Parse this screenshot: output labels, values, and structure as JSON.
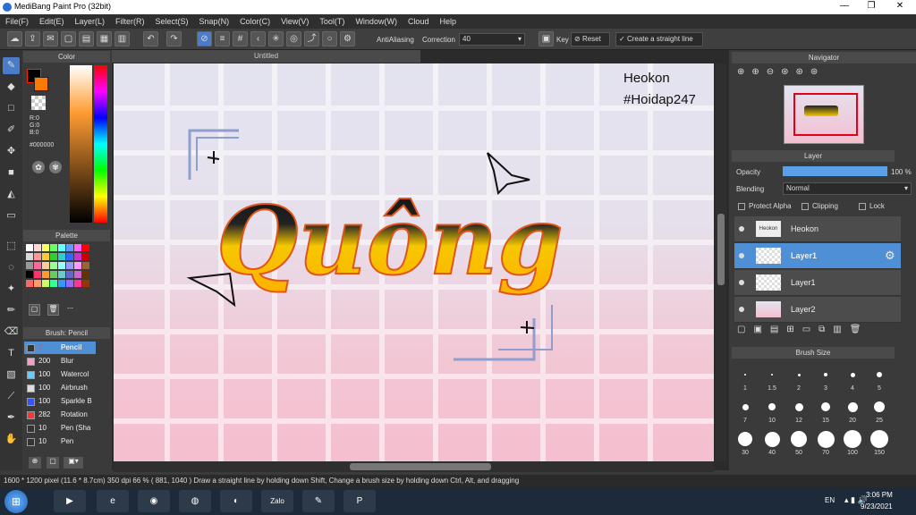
{
  "window": {
    "title": "MediBang Paint Pro (32bit)",
    "minimize": "—",
    "maximize": "❐",
    "close": "✕"
  },
  "menu": [
    "File(F)",
    "Edit(E)",
    "Layer(L)",
    "Filter(R)",
    "Select(S)",
    "Snap(N)",
    "Color(C)",
    "View(V)",
    "Tool(T)",
    "Window(W)",
    "Cloud",
    "Help"
  ],
  "toolbar": {
    "antialiasing": "AntiAliasing",
    "correction_label": "Correction",
    "correction_value": "40",
    "key_label": "Key",
    "reset_label": "Reset",
    "straight_line_label": "Create a straight line"
  },
  "color_panel": {
    "title": "Color",
    "r": "R:0",
    "g": "G:0",
    "b": "B:0",
    "hex": "#000000"
  },
  "palette_panel": {
    "title": "Palette",
    "dash": "---",
    "colors": [
      "#ffffff",
      "#ffd8d8",
      "#ffff66",
      "#66ff66",
      "#66ffff",
      "#6699ff",
      "#ff66ff",
      "#ff0000",
      "#d9d9d9",
      "#ff9999",
      "#ffcc33",
      "#33cc33",
      "#33cccc",
      "#3366ff",
      "#cc33cc",
      "#cc0000",
      "#999999",
      "#ff6699",
      "#ffcc99",
      "#99ff99",
      "#99ffff",
      "#9999ff",
      "#ff99ff",
      "#996633",
      "#000000",
      "#ff3366",
      "#ff9933",
      "#66cc66",
      "#66cccc",
      "#6666cc",
      "#cc66cc",
      "#663300",
      "#ff6666",
      "#ff9966",
      "#ccff66",
      "#33ff99",
      "#3399ff",
      "#9966ff",
      "#ff3399",
      "#993300"
    ]
  },
  "brush_panel": {
    "title": "Brush: Pencil",
    "brushes": [
      {
        "size": "7",
        "name": "Pencil",
        "color": "#333333"
      },
      {
        "size": "200",
        "name": "Blur",
        "color": "#ff99cc"
      },
      {
        "size": "100",
        "name": "Watercol",
        "color": "#66ccff"
      },
      {
        "size": "100",
        "name": "Airbrush",
        "color": "#dddddd"
      },
      {
        "size": "100",
        "name": "Sparkle B",
        "color": "#3355ff"
      },
      {
        "size": "282",
        "name": "Rotation",
        "color": "#ff3333"
      },
      {
        "size": "10",
        "name": "Pen (Sha",
        "color": "#333333"
      },
      {
        "size": "10",
        "name": "Pen",
        "color": "#333333"
      }
    ]
  },
  "canvas": {
    "tab_title": "Untitled",
    "text1": "Heokon",
    "text2": "#Hoidap247",
    "lettering": "Quông"
  },
  "navigator": {
    "title": "Navigator"
  },
  "layer_panel": {
    "title": "Layer",
    "opacity_label": "Opacity",
    "opacity_value": "100 %",
    "opacity_level": 1.0,
    "blending_label": "Blending",
    "blending_value": "Normal",
    "protect_alpha": "Protect Alpha",
    "clipping": "Clipping",
    "lock": "Lock",
    "layers": [
      "Heokon",
      "Layer1",
      "Layer1",
      "Layer2"
    ]
  },
  "brush_size_panel": {
    "title": "Brush Size",
    "sizes": [
      "1",
      "1.5",
      "2",
      "3",
      "4",
      "5",
      "7",
      "10",
      "12",
      "15",
      "20",
      "25",
      "30",
      "40",
      "50",
      "70",
      "100",
      "150"
    ]
  },
  "status": {
    "text": "1600 * 1200 pixel   (11.6 * 8.7cm)   350 dpi   66 %   ( 881, 1040 )   Draw a straight line by holding down Shift, Change a brush size by holding down Ctrl, Alt, and dragging"
  },
  "taskbar": {
    "lang": "EN",
    "time": "3:06 PM",
    "date": "9/23/2021",
    "zalo": "Zalo"
  }
}
